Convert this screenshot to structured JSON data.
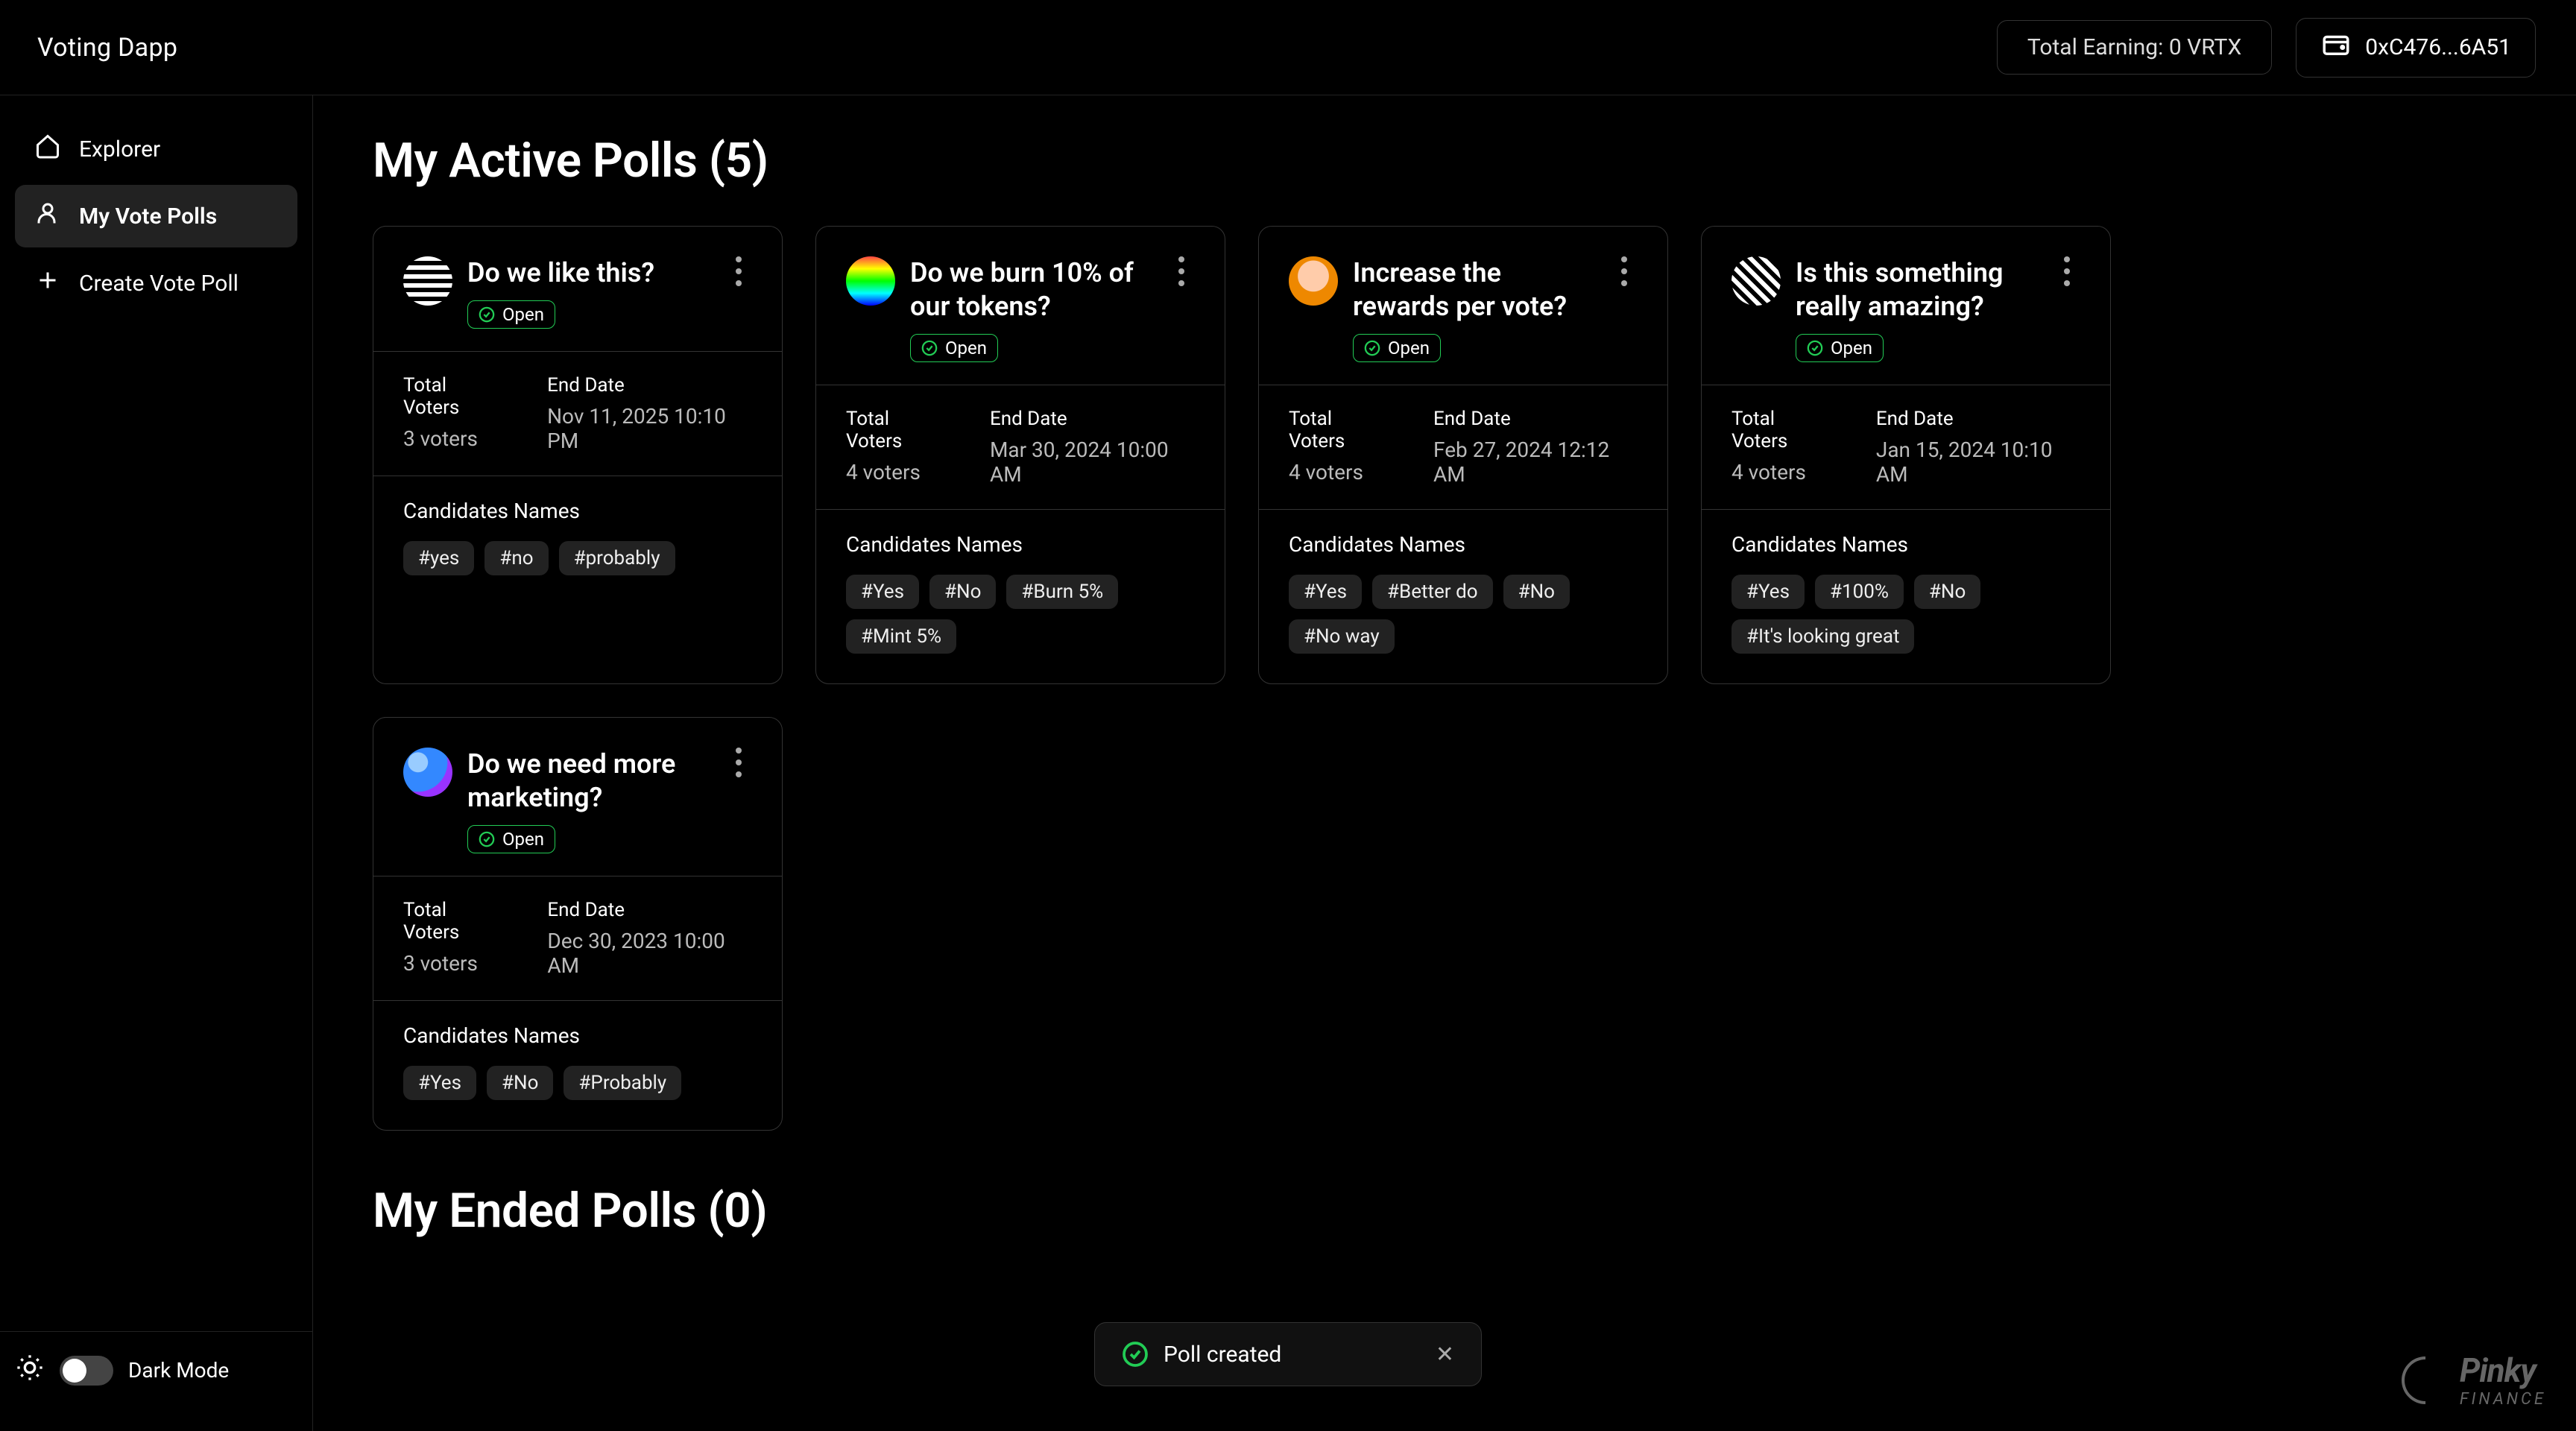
{
  "header": {
    "brand": "Voting Dapp",
    "earning": "Total Earning: 0 VRTX",
    "wallet": "0xC476...6A51"
  },
  "sidebar": {
    "items": [
      {
        "label": "Explorer"
      },
      {
        "label": "My Vote Polls"
      },
      {
        "label": "Create Vote Poll"
      }
    ],
    "dark_mode_label": "Dark Mode"
  },
  "sections": {
    "active_title": "My Active Polls (5)",
    "ended_title": "My Ended Polls (0)"
  },
  "polls": [
    {
      "title": "Do we like this?",
      "status": "Open",
      "voters_label": "Total Voters",
      "voters_value": "3 voters",
      "end_label": "End Date",
      "end_value": "Nov 11, 2025 10:10 PM",
      "cand_label": "Candidates Names",
      "tags": [
        "#yes",
        "#no",
        "#probably"
      ]
    },
    {
      "title": "Do we burn 10% of our tokens?",
      "status": "Open",
      "voters_label": "Total Voters",
      "voters_value": "4 voters",
      "end_label": "End Date",
      "end_value": "Mar 30, 2024 10:00 AM",
      "cand_label": "Candidates Names",
      "tags": [
        "#Yes",
        "#No",
        "#Burn 5%",
        "#Mint 5%"
      ]
    },
    {
      "title": "Increase the rewards per vote?",
      "status": "Open",
      "voters_label": "Total Voters",
      "voters_value": "4 voters",
      "end_label": "End Date",
      "end_value": "Feb 27, 2024 12:12 AM",
      "cand_label": "Candidates Names",
      "tags": [
        "#Yes",
        "#Better do",
        "#No",
        "#No way"
      ]
    },
    {
      "title": "Is this something really amazing?",
      "status": "Open",
      "voters_label": "Total Voters",
      "voters_value": "4 voters",
      "end_label": "End Date",
      "end_value": "Jan 15, 2024 10:10 AM",
      "cand_label": "Candidates Names",
      "tags": [
        "#Yes",
        "#100%",
        "#No",
        "#It's looking great"
      ]
    },
    {
      "title": "Do we need more marketing?",
      "status": "Open",
      "voters_label": "Total Voters",
      "voters_value": "3 voters",
      "end_label": "End Date",
      "end_value": "Dec 30, 2023 10:00 AM",
      "cand_label": "Candidates Names",
      "tags": [
        "#Yes",
        "#No",
        "#Probably"
      ]
    }
  ],
  "toast": {
    "message": "Poll created"
  },
  "footer": {
    "brand": "Pinky",
    "brand_sub": "FINANCE"
  }
}
